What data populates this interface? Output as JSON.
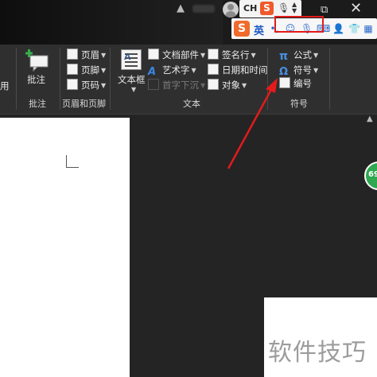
{
  "titlebar": {
    "lang_indicator": "CH",
    "ime_logo": "S",
    "ime_logo_small": "S",
    "ime_lang": "英"
  },
  "ribbon": {
    "edge_text": "用",
    "comment_group": {
      "button_label": "批注",
      "group_label": "批注"
    },
    "header_footer_group": {
      "items": [
        {
          "label": "页眉",
          "icon": "header-icon"
        },
        {
          "label": "页脚",
          "icon": "footer-icon"
        },
        {
          "label": "页码",
          "icon": "page-number-icon"
        }
      ],
      "group_label": "页眉和页脚"
    },
    "text_group": {
      "textbox_label": "文本框",
      "col1": [
        {
          "label": "文档部件",
          "icon": "quick-parts-icon"
        },
        {
          "label": "艺术字",
          "icon": "wordart-icon"
        },
        {
          "label": "首字下沉",
          "icon": "drop-cap-icon",
          "disabled": true
        }
      ],
      "col2": [
        {
          "label": "签名行",
          "icon": "signature-line-icon"
        },
        {
          "label": "日期和时间",
          "icon": "date-time-icon"
        },
        {
          "label": "对象",
          "icon": "object-icon"
        }
      ],
      "group_label": "文本"
    },
    "symbols_group": {
      "items": [
        {
          "label": "公式",
          "icon": "pi-icon",
          "glyph": "π"
        },
        {
          "label": "符号",
          "icon": "omega-icon",
          "glyph": "Ω"
        },
        {
          "label": "编号",
          "icon": "numbering-icon"
        }
      ],
      "group_label": "符号"
    }
  },
  "document": {
    "scroll_badge": "69"
  },
  "watermark": "软件技巧",
  "colors": {
    "highlight": "#e21b1b",
    "ribbon_bg": "#2f2f2f",
    "app_bg": "#242424"
  }
}
